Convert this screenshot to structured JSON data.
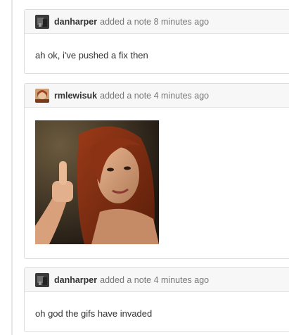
{
  "notes": [
    {
      "author": "danharper",
      "action": "added a note 8 minutes ago",
      "avatar": "avatar-danharper",
      "text": "ah ok, i've pushed a fix then"
    },
    {
      "author": "rmlewisuk",
      "action": "added a note 4 minutes ago",
      "avatar": "avatar-rmlewisuk",
      "image": "thumbs-up-gif"
    },
    {
      "author": "danharper",
      "action": "added a note 4 minutes ago",
      "avatar": "avatar-danharper",
      "text": "oh god the gifs have invaded"
    }
  ],
  "colors": {
    "header_bg": "#f7f7f7",
    "border": "#dcdcdc",
    "meta_text": "#777777",
    "author_text": "#333333"
  }
}
